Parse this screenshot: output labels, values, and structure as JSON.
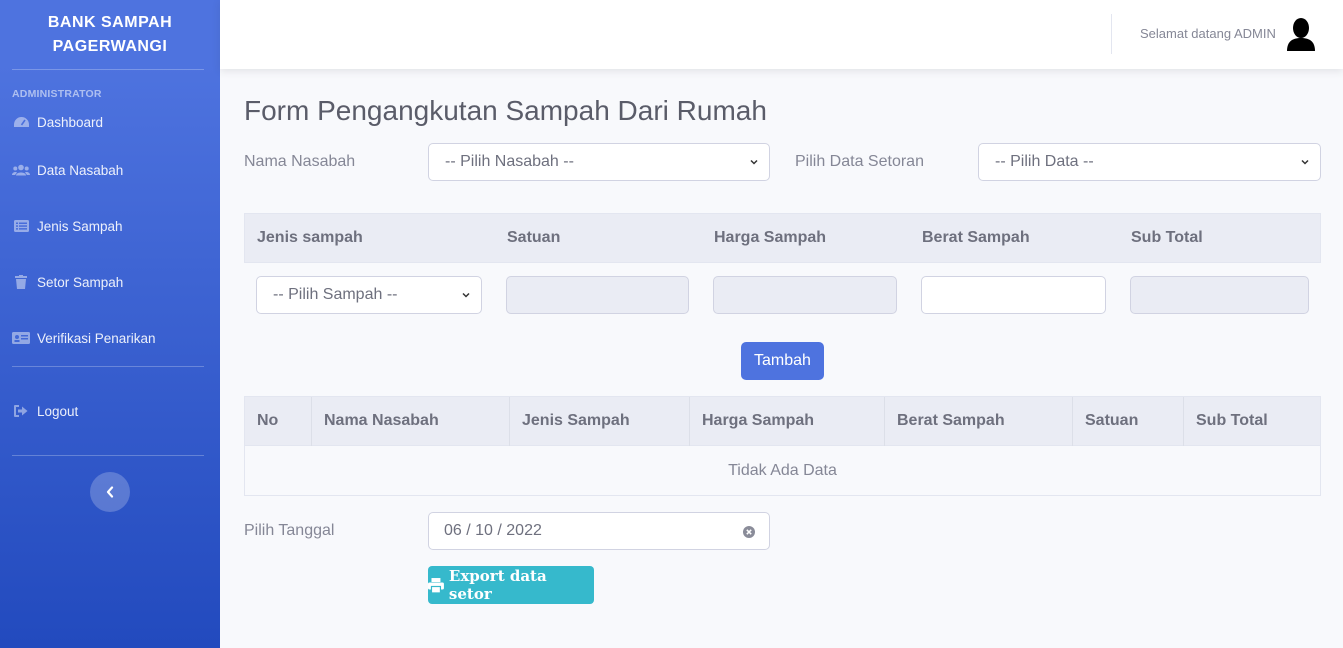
{
  "sidebar": {
    "brand_line1": "BANK SAMPAH",
    "brand_line2": "PAGERWANGI",
    "heading": "ADMINISTRATOR",
    "items": [
      {
        "label": "Dashboard",
        "icon": "tachometer-icon"
      },
      {
        "label": "Data Nasabah",
        "icon": "users-icon"
      },
      {
        "label": "Jenis Sampah",
        "icon": "list-icon"
      },
      {
        "label": "Setor Sampah",
        "icon": "trash-icon"
      },
      {
        "label": "Verifikasi Penarikan",
        "icon": "id-card-icon"
      }
    ],
    "logout_label": "Logout",
    "toggle_icon": "chevron-left-icon"
  },
  "topbar": {
    "welcome": "Selamat datang ADMIN",
    "avatar_icon": "user-silhouette-icon"
  },
  "form": {
    "title": "Form Pengangkutan Sampah Dari Rumah",
    "nama_nasabah_label": "Nama Nasabah",
    "nama_nasabah_select": "-- Pilih Nasabah --",
    "data_setoran_label": "Pilih Data Setoran",
    "data_setoran_select": "-- Pilih Data --"
  },
  "input_table": {
    "headers": [
      "Jenis sampah",
      "Satuan",
      "Harga Sampah",
      "Berat Sampah",
      "Sub Total"
    ],
    "jenis_select": "-- Pilih Sampah --",
    "add_button": "Tambah"
  },
  "data_table": {
    "headers": [
      "No",
      "Nama Nasabah",
      "Jenis Sampah",
      "Harga Sampah",
      "Berat Sampah",
      "Satuan",
      "Sub Total"
    ],
    "empty_text": "Tidak Ada Data"
  },
  "date": {
    "label": "Pilih Tanggal",
    "value": "06 / 10 / 2022"
  },
  "export_button": "Export data setor",
  "colors": {
    "primary": "#4e73df",
    "info": "#36b9cc",
    "sidebar_dark": "#224abe"
  }
}
